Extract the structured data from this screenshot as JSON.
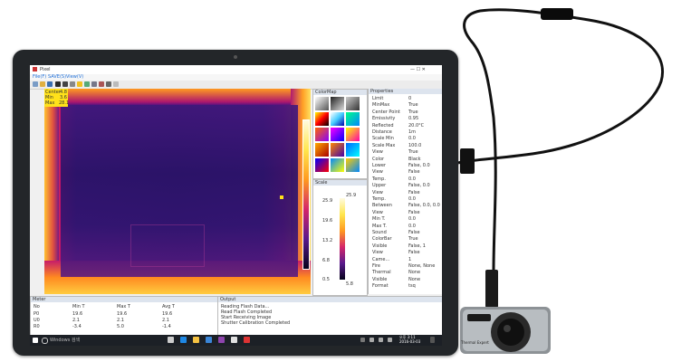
{
  "window": {
    "title": "Pixel",
    "controls": "— ☐ ✕"
  },
  "menu": {
    "items": [
      "File(F)",
      "SAVE(S)",
      "View(V)"
    ]
  },
  "stats": {
    "center_label": "Center",
    "center_value": "4.8",
    "min_label": "Min",
    "min_value": "3.6",
    "max_label": "Max",
    "max_value": "28.1"
  },
  "colormap_panel": {
    "title": "ColorMap"
  },
  "scale_panel": {
    "title": "Scale",
    "max_value": "25.9",
    "min_value": "5.8",
    "ticks": [
      "25.9",
      "19.6",
      "13.2",
      "6.8",
      "0.5"
    ]
  },
  "properties": {
    "title": "Properties",
    "rows": [
      {
        "k": "Limit",
        "v": "0"
      },
      {
        "k": "MinMax",
        "v": "True"
      },
      {
        "k": "Center Point",
        "v": "True"
      },
      {
        "k": "Emissivity",
        "v": "0.95"
      },
      {
        "k": "Reflected",
        "v": "20.0°C"
      },
      {
        "k": "Distance",
        "v": "1m"
      },
      {
        "k": "Scale Min",
        "v": "0.0"
      },
      {
        "k": "Scale Max",
        "v": "100.0"
      },
      {
        "k": "View",
        "v": "True"
      },
      {
        "k": "Color",
        "v": "Black"
      },
      {
        "k": "Lower",
        "v": "False, 0.0"
      },
      {
        "k": "View",
        "v": "False"
      },
      {
        "k": "Temp.",
        "v": "0.0"
      },
      {
        "k": "Upper",
        "v": "False, 0.0"
      },
      {
        "k": "View",
        "v": "False"
      },
      {
        "k": "Temp.",
        "v": "0.0"
      },
      {
        "k": "Between",
        "v": "False, 0.0, 0.0"
      },
      {
        "k": "View",
        "v": "False"
      },
      {
        "k": "Min T.",
        "v": "0.0"
      },
      {
        "k": "Max T.",
        "v": "0.0"
      },
      {
        "k": "Sound",
        "v": "False"
      },
      {
        "k": "ColorBar",
        "v": "True"
      },
      {
        "k": "Visible",
        "v": "False, 1"
      },
      {
        "k": "View",
        "v": "False"
      },
      {
        "k": "Came...",
        "v": "1"
      },
      {
        "k": "Fire",
        "v": "None, None"
      },
      {
        "k": "Thermal",
        "v": "None"
      },
      {
        "k": "Visible",
        "v": "None"
      },
      {
        "k": "Format",
        "v": "tsq"
      }
    ]
  },
  "meter_panel": {
    "title": "Meter",
    "headers": [
      "No",
      "Min T",
      "Max T",
      "Avg T"
    ],
    "rows": [
      [
        "P0",
        "19.6",
        "19.6",
        "19.6"
      ],
      [
        "U0",
        "2.1",
        "2.1",
        "2.1"
      ],
      [
        "R0",
        "-3.4",
        "5.0",
        "-1.4"
      ]
    ]
  },
  "output_panel": {
    "title": "Output",
    "lines": [
      "Reading Flash Data...",
      "Read Flash Completed",
      "Start Receiving Image",
      "Shutter Calibration Completed"
    ]
  },
  "taskbar": {
    "search_placeholder": "Windows 검색",
    "time": "오후 3:11",
    "date": "2016-03-03"
  },
  "camera": {
    "brand": "Thermal Expert"
  },
  "colors": {
    "accent": "#1e6fd9",
    "taskbar": "#1c2026"
  }
}
